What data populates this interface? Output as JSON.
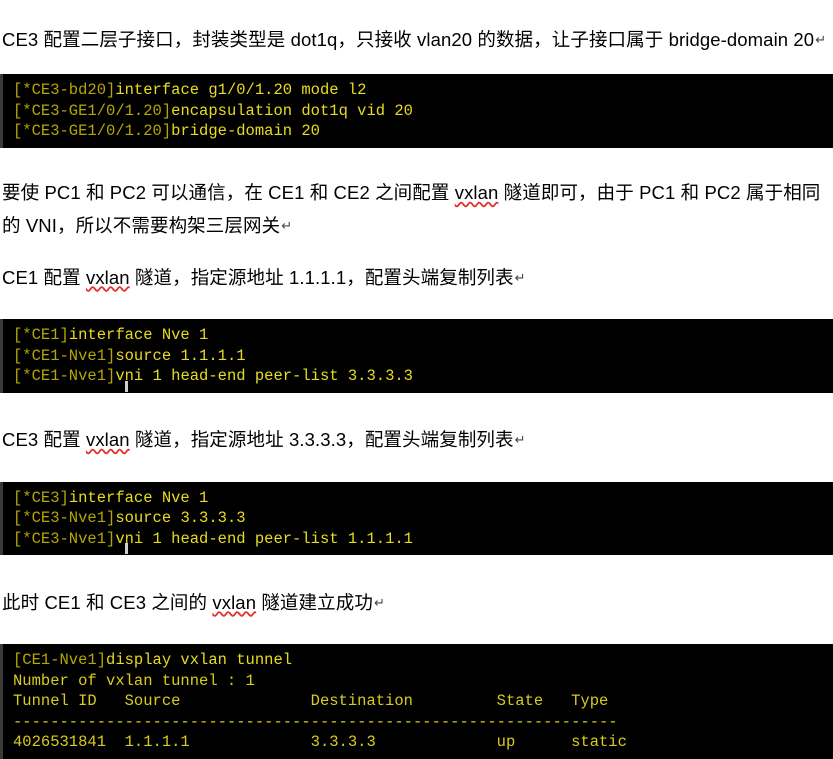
{
  "document": {
    "paragraphs": {
      "p1": {
        "segments": [
          {
            "text": "CE3 配置二层子接口，封装类型是 dot1q，只接收 vlan20 的数据，让子接口属于 bridge-domain 20",
            "misspelled": false
          }
        ],
        "pilcrow": "↵"
      },
      "p2": {
        "segments": [
          {
            "text": "要使 PC1 和 PC2 可以通信，在 CE1 和 CE2 之间配置 ",
            "misspelled": false
          },
          {
            "text": "vxlan",
            "misspelled": true
          },
          {
            "text": " 隧道即可，由于 PC1 和 PC2 属于相同的 VNI，所以不需要构架三层网关",
            "misspelled": false
          }
        ],
        "pilcrow": "↵"
      },
      "p3": {
        "segments": [
          {
            "text": "CE1 配置 ",
            "misspelled": false
          },
          {
            "text": "vxlan",
            "misspelled": true
          },
          {
            "text": " 隧道，指定源地址 1.1.1.1，配置头端复制列表",
            "misspelled": false
          }
        ],
        "pilcrow": "↵"
      },
      "p4": {
        "segments": [
          {
            "text": "CE3 配置 ",
            "misspelled": false
          },
          {
            "text": "vxlan",
            "misspelled": true
          },
          {
            "text": " 隧道，指定源地址 3.3.3.3，配置头端复制列表",
            "misspelled": false
          }
        ],
        "pilcrow": "↵"
      },
      "p5": {
        "segments": [
          {
            "text": "此时 CE1 和 CE3 之间的 ",
            "misspelled": false
          },
          {
            "text": "vxlan",
            "misspelled": true
          },
          {
            "text": " 隧道建立成功",
            "misspelled": false
          }
        ],
        "pilcrow": "↵"
      }
    },
    "terminals": {
      "t1": {
        "name": "ce3-subinterface-config",
        "has_cursor": false,
        "lines": [
          {
            "prompt": "[*CE3-bd20]",
            "command": "interface g1/0/1.20 mode l2"
          },
          {
            "prompt": "[*CE3-GE1/0/1.20]",
            "command": "encapsulation dot1q vid 20"
          },
          {
            "prompt": "[*CE3-GE1/0/1.20]",
            "command": "bridge-domain 20"
          }
        ]
      },
      "t2": {
        "name": "ce1-nve-config",
        "has_cursor": true,
        "lines": [
          {
            "prompt": "[*CE1]",
            "command": "interface Nve 1"
          },
          {
            "prompt": "[*CE1-Nve1]",
            "command": "source 1.1.1.1"
          },
          {
            "prompt": "[*CE1-Nve1]",
            "command": "vni 1 head-end peer-list 3.3.3.3"
          }
        ]
      },
      "t3": {
        "name": "ce3-nve-config",
        "has_cursor": true,
        "lines": [
          {
            "prompt": "[*CE3]",
            "command": "interface Nve 1"
          },
          {
            "prompt": "[*CE3-Nve1]",
            "command": "source 3.3.3.3"
          },
          {
            "prompt": "[*CE3-Nve1]",
            "command": "vni 1 head-end peer-list 1.1.1.1"
          }
        ]
      },
      "t4": {
        "name": "display-vxlan-tunnel-output",
        "has_cursor": false,
        "lines": [
          {
            "prompt": "[CE1-Nve1]",
            "command": "display vxlan tunnel"
          },
          {
            "prompt": "",
            "command": "",
            "output": "Number of vxlan tunnel : 1"
          },
          {
            "prompt": "",
            "command": "",
            "output": "Tunnel ID   Source              Destination         State   Type"
          },
          {
            "prompt": "",
            "command": "",
            "output": "-----------------------------------------------------------------"
          },
          {
            "prompt": "",
            "command": "",
            "output": "4026531841  1.1.1.1             3.3.3.3             up      static"
          }
        ],
        "table": {
          "headers": [
            "Tunnel ID",
            "Source",
            "Destination",
            "State",
            "Type"
          ],
          "rows": [
            [
              "4026531841",
              "1.1.1.1",
              "3.3.3.3",
              "up",
              "static"
            ]
          ],
          "count_label": "Number of vxlan tunnel : 1",
          "count": 1
        }
      }
    }
  },
  "colors": {
    "terminal_background": "#000000",
    "terminal_prompt": "#b5a700",
    "terminal_command": "#e8dc1f",
    "terminal_output": "#d8cb1d",
    "page_background": "#ffffff",
    "body_text": "#000000",
    "spellcheck_underline": "#e03030",
    "cursor": "#cfcfcf"
  }
}
